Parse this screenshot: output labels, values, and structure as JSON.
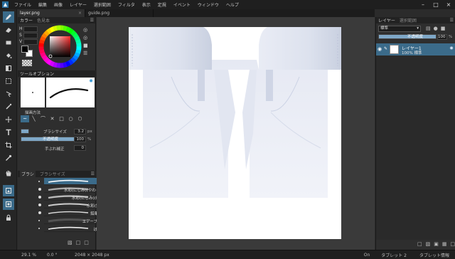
{
  "menu": [
    "ファイル",
    "編集",
    "画像",
    "レイヤー",
    "選択範囲",
    "フィルタ",
    "表示",
    "定規",
    "イベント",
    "ウィンドウ",
    "ヘルプ"
  ],
  "tabs": [
    {
      "label": "layer.png",
      "active": true
    },
    {
      "label": "guide.png",
      "active": false
    }
  ],
  "color_panel": {
    "title": "カラー",
    "subtitle": "色見本",
    "fields": [
      "H",
      "S",
      "V"
    ],
    "primary_color": "#000000",
    "secondary_color": "#ffffff"
  },
  "tool_options": {
    "title": "ツールオプション",
    "draw_method_label": "描画方法",
    "brush_size_label": "ブラシサイズ",
    "brush_size_value": "3.2",
    "brush_size_unit": "px",
    "opacity_label": "不透明度",
    "opacity_value": "100",
    "opacity_unit": "%",
    "stabilizer_label": "手ぶれ補正",
    "stabilizer_value": "0"
  },
  "brush_panel": {
    "tab_brush": "ブラシ",
    "tab_brush_size": "ブラシサイズ",
    "brushes": [
      "ペン",
      "水彩(にじみ)(やわらか)",
      "水彩(にじみ)(硬い)",
      "水彩(鉛筆)",
      "鉛筆(描)",
      "エアーブラシ",
      "ぼかし"
    ]
  },
  "layers_panel": {
    "tab_layers": "レイヤー",
    "tab_navigator": "選択範囲",
    "blend_mode": "標準",
    "opacity_label": "不透明度",
    "opacity_value": "100",
    "opacity_unit": "%",
    "layers": [
      {
        "name": "レイヤー1",
        "info": "100% 標準"
      }
    ]
  },
  "status": {
    "zoom": "29.1 %",
    "angle": "0.0 °",
    "size": "2048 × 2048 px",
    "on": "On",
    "tablet": "タブレット 2",
    "tablet_info": "タブレット情報"
  },
  "accent_color": "#3b6b8a"
}
